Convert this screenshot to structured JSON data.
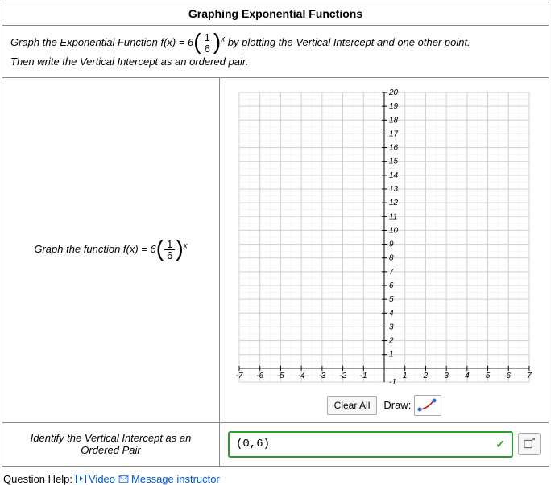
{
  "title": "Graphing Exponential Functions",
  "instructions": {
    "pre": "Graph the Exponential Function ",
    "func_lhs": "f(x) = 6",
    "frac_num": "1",
    "frac_den": "6",
    "exp": "x",
    "mid": " by plotting the Vertical Intercept and one other point.",
    "line2": "Then write the Vertical Intercept as an ordered pair."
  },
  "graph_prompt": {
    "pre": "Graph the function ",
    "func_lhs": "f(x) = 6",
    "frac_num": "1",
    "frac_den": "6",
    "exp": "x"
  },
  "toolbar": {
    "clear_label": "Clear All",
    "draw_label": "Draw:"
  },
  "identify": {
    "label_l1": "Identify the Vertical Intercept as an",
    "label_l2": "Ordered Pair",
    "answer": "(0,6)"
  },
  "help": {
    "label": "Question Help:",
    "video": "Video",
    "msg": "Message instructor"
  },
  "chart_data": {
    "type": "scatter",
    "title": "",
    "xlabel": "",
    "ylabel": "",
    "xlim": [
      -7,
      7
    ],
    "ylim": [
      -1,
      20
    ],
    "x_ticks": [
      -7,
      -6,
      -5,
      -4,
      -3,
      -2,
      -1,
      1,
      2,
      3,
      4,
      5,
      6,
      7
    ],
    "y_ticks": [
      1,
      2,
      3,
      4,
      5,
      6,
      7,
      8,
      9,
      10,
      11,
      12,
      13,
      14,
      15,
      16,
      17,
      18,
      19,
      20
    ],
    "series": []
  }
}
